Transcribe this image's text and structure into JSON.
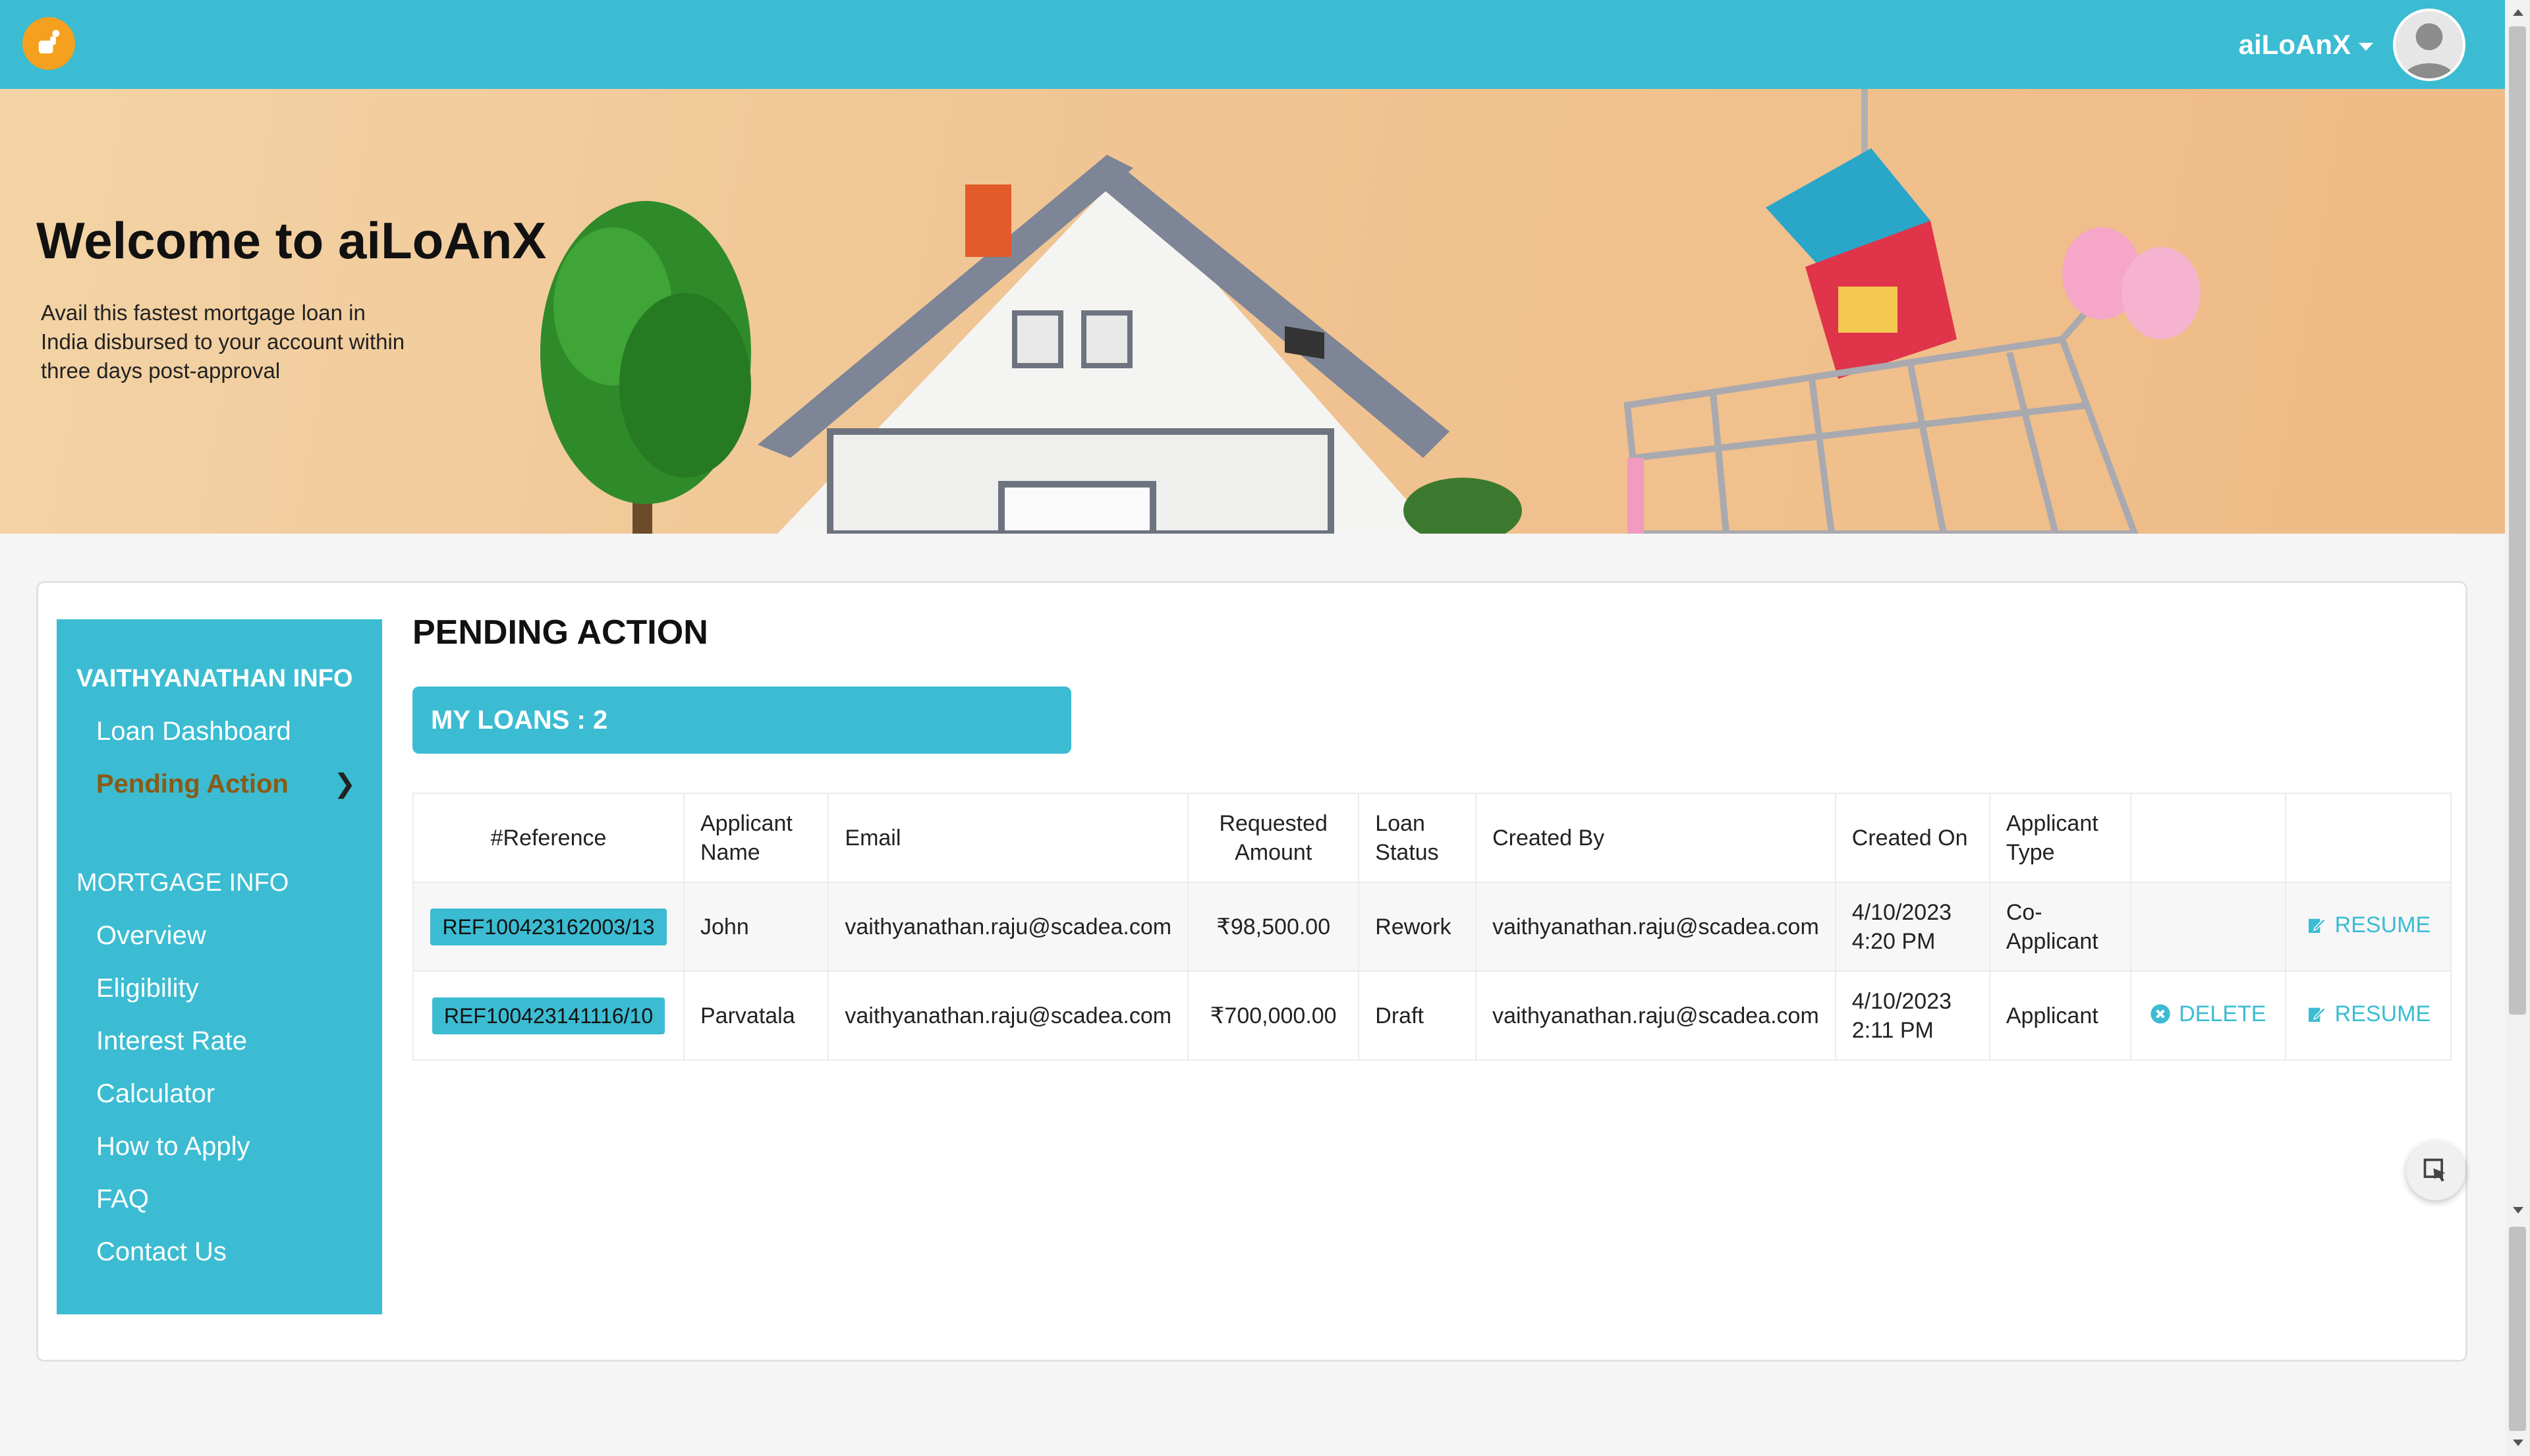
{
  "header": {
    "logo_icon": "hand-coins-icon",
    "user_name": "aiLoAnX",
    "avatar_icon": "user-avatar-icon"
  },
  "banner": {
    "title": "Welcome to aiLoAnX",
    "tagline": "Avail this fastest mortgage loan in India disbursed to your account within three days post-approval"
  },
  "sidebar": {
    "section1": "VAITHYANATHAN INFO",
    "section1_items": [
      {
        "label": "Loan Dashboard"
      },
      {
        "label": "Pending Action"
      }
    ],
    "section2": "MORTGAGE INFO",
    "section2_items": [
      {
        "label": "Overview"
      },
      {
        "label": "Eligibility"
      },
      {
        "label": "Interest Rate"
      },
      {
        "label": "Calculator"
      },
      {
        "label": "How to Apply"
      },
      {
        "label": "FAQ"
      },
      {
        "label": "Contact Us"
      }
    ]
  },
  "main": {
    "title": "PENDING ACTION",
    "my_loans": "MY LOANS : 2",
    "columns": [
      "#Reference",
      "Applicant Name",
      "Email",
      "Requested Amount",
      "Loan Status",
      "Created By",
      "Created On",
      "Applicant Type",
      "",
      ""
    ],
    "rows": [
      {
        "reference": "REF100423162003/13",
        "applicant_name": "John",
        "email": "vaithyanathan.raju@scadea.com",
        "amount": "₹98,500.00",
        "status": "Rework",
        "created_by": "vaithyanathan.raju@scadea.com",
        "created_on_date": "4/10/2023",
        "created_on_time": "4:20 PM",
        "applicant_type": "Co-Applicant",
        "delete_label": "",
        "resume_label": "RESUME"
      },
      {
        "reference": "REF100423141116/10",
        "applicant_name": "Parvatala",
        "email": "vaithyanathan.raju@scadea.com",
        "amount": "₹700,000.00",
        "status": "Draft",
        "created_by": "vaithyanathan.raju@scadea.com",
        "created_on_date": "4/10/2023",
        "created_on_time": "2:11 PM",
        "applicant_type": "Applicant",
        "delete_label": "DELETE",
        "resume_label": "RESUME"
      }
    ]
  },
  "colors": {
    "accent": "#3bbcd2",
    "active_nav": "#8b5a14",
    "logo": "#f5a01e"
  }
}
